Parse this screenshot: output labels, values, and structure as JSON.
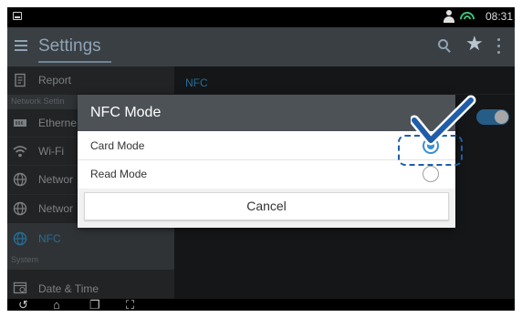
{
  "status_bar": {
    "time": "08:31"
  },
  "action_bar": {
    "title": "Settings"
  },
  "sidebar": {
    "items": [
      {
        "label": "Report"
      },
      {
        "label": "Etherne"
      },
      {
        "label": "Wi-Fi"
      },
      {
        "label": "Networ"
      },
      {
        "label": "Networ"
      },
      {
        "label": "NFC"
      },
      {
        "label": "Date & Time"
      }
    ],
    "sections": [
      {
        "label": "Network Settin"
      },
      {
        "label": "System"
      }
    ]
  },
  "content": {
    "title": "NFC",
    "toggle_on": true
  },
  "dialog": {
    "title": "NFC Mode",
    "options": [
      {
        "label": "Card Mode",
        "selected": true
      },
      {
        "label": "Read Mode",
        "selected": false
      }
    ],
    "cancel_label": "Cancel"
  },
  "colors": {
    "accent": "#3a8fd0",
    "action_bar": "#3a3f44",
    "annotation": "#1f5da8"
  }
}
